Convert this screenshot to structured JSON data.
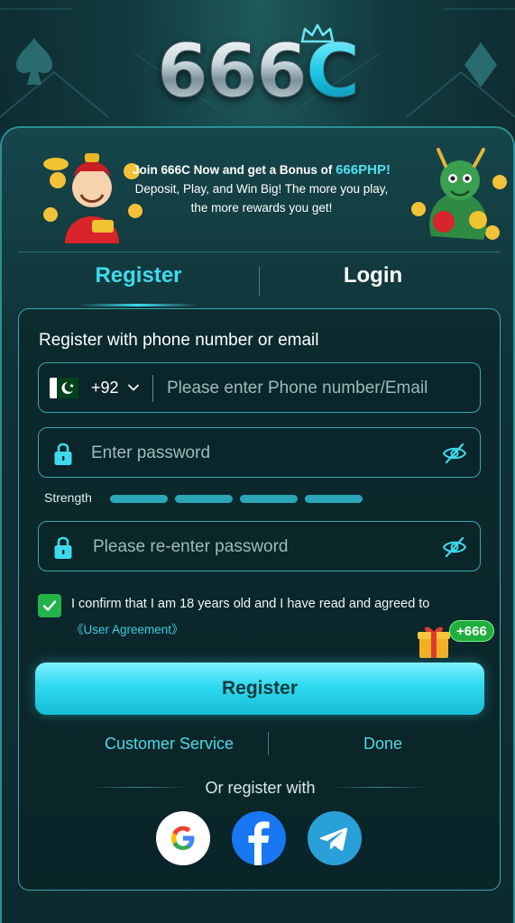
{
  "brand": {
    "logo_text": "666",
    "logo_accent": "C"
  },
  "banner": {
    "line1_prefix": "Join 666C Now and get a Bonus of ",
    "line1_highlight": "666PHP!",
    "line2": "Deposit, Play, and Win Big!  The more you play,",
    "line3": "the more rewards you get!"
  },
  "tabs": {
    "register": "Register",
    "login": "Login",
    "active": "register"
  },
  "form": {
    "heading": "Register with phone number or email",
    "phone": {
      "country_code": "+92",
      "country": "pakistan-flag",
      "placeholder": "Please enter Phone number/Email"
    },
    "password": {
      "placeholder": "Enter password"
    },
    "strength": {
      "label": "Strength",
      "segments": 4,
      "filled": 0
    },
    "confirm_password": {
      "placeholder": "Please re-enter password"
    },
    "agreement": {
      "checked": true,
      "text": "I confirm that  I am 18 years old and I have read and agreed to",
      "link": "《User Agreement》"
    },
    "bonus_badge": "+666",
    "submit_label": "Register"
  },
  "links": {
    "customer_service": "Customer Service",
    "done": "Done"
  },
  "social": {
    "heading": "Or register with",
    "providers": [
      "google",
      "facebook",
      "telegram"
    ]
  },
  "colors": {
    "accent": "#3fd9ec",
    "background": "#0d2b2f",
    "check_green": "#24b34a",
    "facebook": "#1877f2",
    "telegram": "#2aa0d8"
  }
}
